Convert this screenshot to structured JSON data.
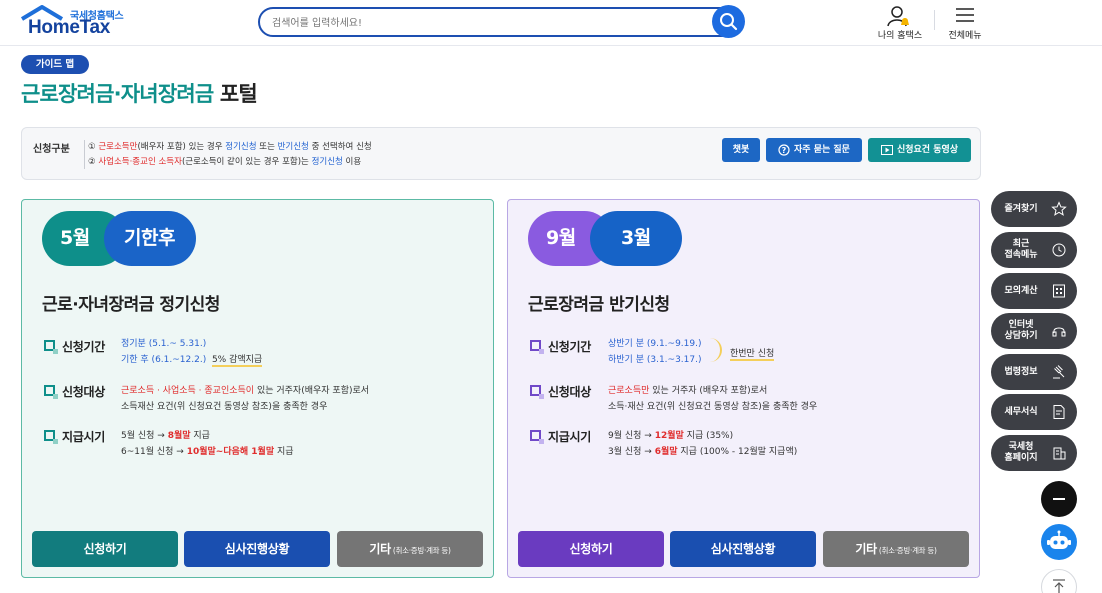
{
  "header": {
    "logo_small": "국세청홈택스",
    "logo_main": "HomeTax",
    "search_placeholder": "검색어를 입력하세요!",
    "myhome_label": "나의 홈택스",
    "allmenu_label": "전체메뉴"
  },
  "title_area": {
    "guide_badge": "가이드 맵",
    "title_accent": "근로장려금·자녀장려금",
    "title_rest": " 포털"
  },
  "infobar": {
    "label": "신청구분",
    "line1": {
      "n": "① ",
      "a": "근로소득만",
      "b": "(배우자 포함) 있는 경우 ",
      "c": "정기신청",
      "d": " 또는 ",
      "e": "반기신청",
      "f": " 중 선택하여 신청"
    },
    "line2": {
      "n": "② ",
      "a": "사업소득·종교인 소득자",
      "b": "(근로소득이 같이 있는 경우 포함)는 ",
      "c": "정기신청",
      "d": " 이용"
    },
    "buttons": {
      "chat": "챗봇",
      "faq": "자주 묻는 질문",
      "video": "신청요건 동영상"
    }
  },
  "card_left": {
    "pill_a": "5월",
    "pill_b": "기한후",
    "title": "근로·자녀장려금 정기신청",
    "period_label": "신청기간",
    "period_line1": "정기분 (5.1.~ 5.31.)",
    "period_line2": "기한 후 (6.1.~12.2.)",
    "period_note": "5% 감액지급",
    "target_label": "신청대상",
    "target_red": "근로소득 · 사업소득 · 종교인소득이",
    "target_rest": " 있는 거주자(배우자 포함)로서",
    "target_line2": "소득재산 요건(위 신청요건 동영상 참조)을 충족한 경우",
    "pay_label": "지급시기",
    "pay1_a": "5월 신청 → ",
    "pay1_b": "8월말",
    "pay1_c": " 지급",
    "pay2_a": "6~11월 신청 → ",
    "pay2_b": "10월말~다음해 1월말",
    "pay2_c": " 지급",
    "btn_apply": "신청하기",
    "btn_status": "심사진행상황",
    "btn_etc": "기타",
    "btn_etc_small": "(취소·증빙·계좌 등)"
  },
  "card_right": {
    "pill_a": "9월",
    "pill_b": "3월",
    "title": "근로장려금 반기신청",
    "period_label": "신청기간",
    "period_line1": "상반기 분 (9.1.~9.19.)",
    "period_line2": "하반기 분 (3.1.~3.17.)",
    "period_note": "한번만 신청",
    "target_label": "신청대상",
    "target_red": "근로소득만",
    "target_rest": " 있는 거주자 (배우자 포함)로서",
    "target_line2": "소득·재산 요건(위 신청요건 동영상 참조)을 충족한 경우",
    "pay_label": "지급시기",
    "pay1_a": "9월 신청 → ",
    "pay1_b": "12월말",
    "pay1_c": " 지급 (35%)",
    "pay2_a": "3월 신청 → ",
    "pay2_b": "6월말",
    "pay2_c": " 지급 (100% - 12월말 지급액)",
    "btn_apply": "신청하기",
    "btn_status": "심사진행상황",
    "btn_etc": "기타",
    "btn_etc_small": "(취소·증빙·계좌 등)"
  },
  "quick_menu": {
    "favorites": "즐겨찾기",
    "recent_1": "최근",
    "recent_2": "접속메뉴",
    "simulation": "모의계산",
    "consult_1": "인터넷",
    "consult_2": "상담하기",
    "law": "법령정보",
    "forms": "세무서식",
    "nts_1": "국세청",
    "nts_2": "홈페이지"
  },
  "colors": {
    "teal": "#0e8f8a",
    "blue": "#1a64c8",
    "purple": "#8a5be0",
    "red": "#e02d2d"
  }
}
